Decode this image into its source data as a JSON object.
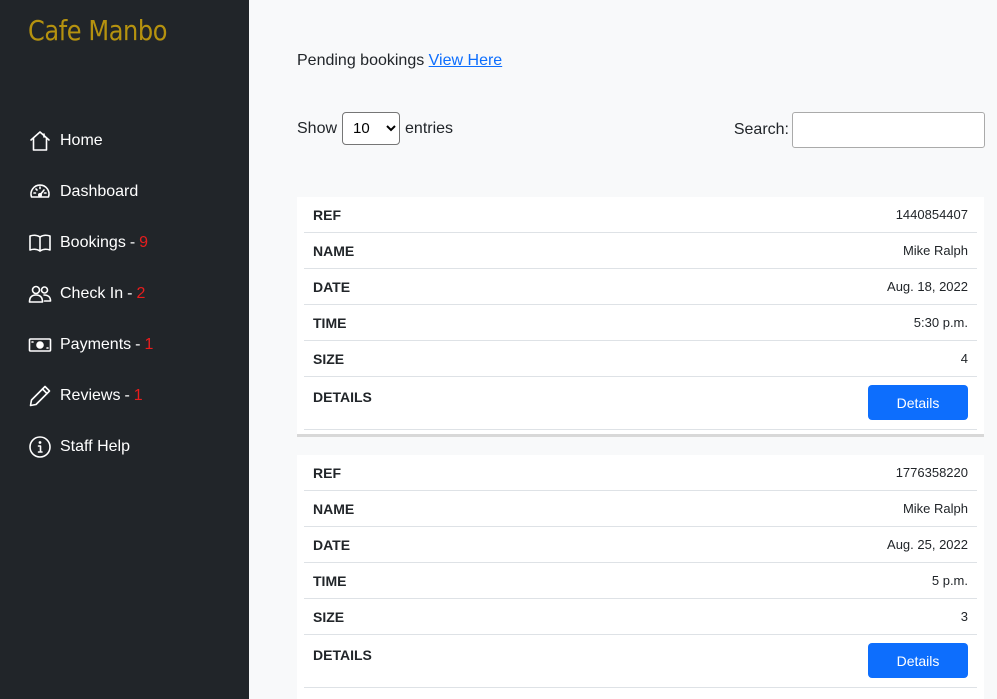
{
  "brand": "Cafe Manbo",
  "sidebar": {
    "items": [
      {
        "label": "Home",
        "icon": "house-icon"
      },
      {
        "label": "Dashboard",
        "icon": "speedometer-icon"
      },
      {
        "label": "Bookings",
        "sep": "-",
        "count": "9",
        "icon": "book-icon"
      },
      {
        "label": "Check In",
        "sep": "-",
        "count": "2",
        "icon": "people-icon"
      },
      {
        "label": "Payments",
        "sep": "-",
        "count": "1",
        "icon": "cash-icon"
      },
      {
        "label": "Reviews",
        "sep": "-",
        "count": "1",
        "icon": "pencil-icon"
      },
      {
        "label": "Staff Help",
        "icon": "info-circle-icon"
      }
    ]
  },
  "pending": {
    "text": "Pending bookings",
    "link": "View Here"
  },
  "table_controls": {
    "show_label": "Show",
    "entries_value": "10",
    "entries_label": "entries",
    "search_label": "Search:",
    "search_value": ""
  },
  "bookings": [
    {
      "rows": [
        {
          "key": "REF",
          "value": "1440854407"
        },
        {
          "key": "NAME",
          "value": "Mike Ralph"
        },
        {
          "key": "DATE",
          "value": "Aug. 18, 2022"
        },
        {
          "key": "TIME",
          "value": "5:30 p.m."
        },
        {
          "key": "SIZE",
          "value": "4"
        }
      ],
      "details_key": "DETAILS",
      "details_button": "Details"
    },
    {
      "rows": [
        {
          "key": "REF",
          "value": "1776358220"
        },
        {
          "key": "NAME",
          "value": "Mike Ralph"
        },
        {
          "key": "DATE",
          "value": "Aug. 25, 2022"
        },
        {
          "key": "TIME",
          "value": "5 p.m."
        },
        {
          "key": "SIZE",
          "value": "3"
        }
      ],
      "details_key": "DETAILS",
      "details_button": "Details"
    }
  ],
  "colors": {
    "brand": "#b5920f",
    "sidebar_bg": "#212529",
    "count": "#e81d1d",
    "primary": "#0d6efd"
  }
}
